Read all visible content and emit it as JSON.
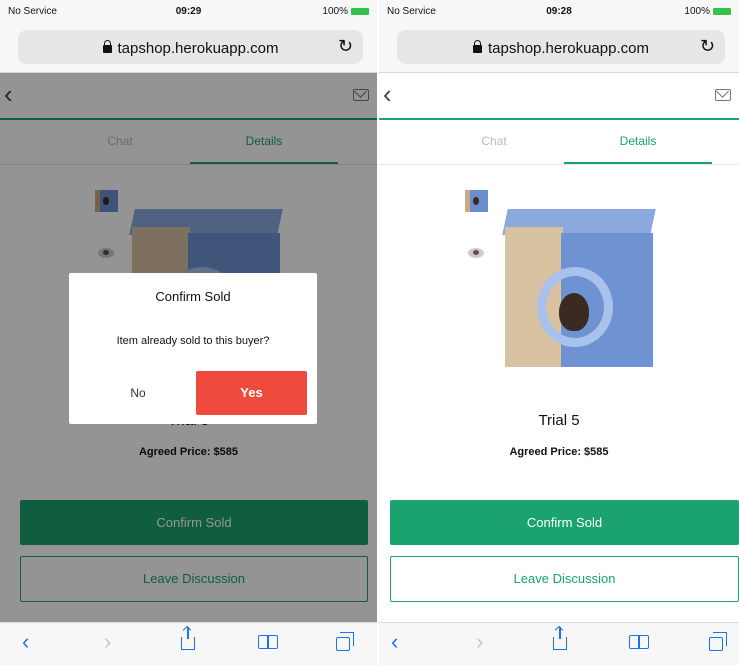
{
  "left": {
    "status": {
      "carrier": "No Service",
      "time": "09:29",
      "battery": "100%"
    },
    "url": "tapshop.herokuapp.com",
    "tabs": {
      "chat": "Chat",
      "details": "Details"
    },
    "item": {
      "title": "Trial 5",
      "agreed_price": "Agreed Price: $585"
    },
    "buttons": {
      "confirm_sold": "Confirm Sold",
      "leave_discussion": "Leave Discussion"
    },
    "dialog": {
      "title": "Confirm Sold",
      "message": "Item already sold to this buyer?",
      "no_label": "No",
      "yes_label": "Yes"
    }
  },
  "right": {
    "status": {
      "carrier": "No Service",
      "time": "09:28",
      "battery": "100%"
    },
    "url": "tapshop.herokuapp.com",
    "tabs": {
      "chat": "Chat",
      "details": "Details"
    },
    "item": {
      "title": "Trial 5",
      "agreed_price": "Agreed Price: $585"
    },
    "buttons": {
      "confirm_sold": "Confirm Sold",
      "leave_discussion": "Leave Discussion"
    }
  },
  "icons": {
    "back": "back-chevron-icon",
    "mail": "mail-icon",
    "lock": "lock-icon",
    "reload": "reload-icon",
    "share": "share-icon",
    "bookmarks": "bookmarks-icon",
    "tabs": "tabs-icon"
  },
  "colors": {
    "accent": "#1aa36f",
    "danger": "#ee4a3e",
    "browser_blue": "#1a73e8"
  }
}
